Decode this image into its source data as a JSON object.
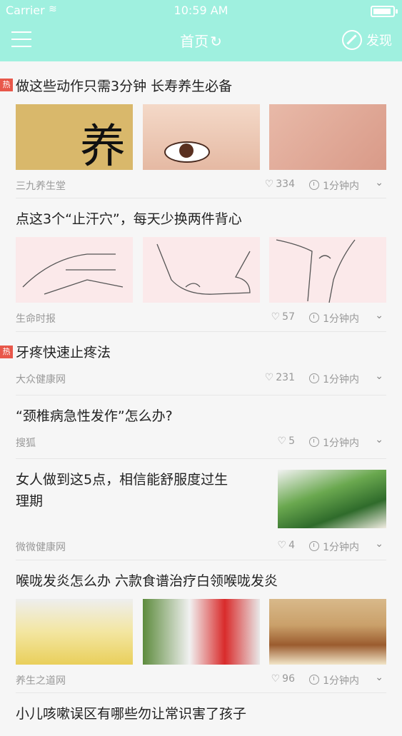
{
  "status_bar": {
    "carrier": "Carrier",
    "time": "10:59 AM"
  },
  "header": {
    "title": "首页",
    "discover_label": "发现"
  },
  "feed": [
    {
      "title": "做这些动作只需3分钟 长寿养生必备",
      "hot": "热",
      "source": "三九养生堂",
      "likes": "334",
      "time": "1分钟内",
      "thumb_text": "养"
    },
    {
      "title": "点这3个“止汗穴”，每天少换两件背心",
      "hot": "",
      "source": "生命时报",
      "likes": "57",
      "time": "1分钟内"
    },
    {
      "title": "牙疼快速止疼法",
      "hot": "热",
      "source": "大众健康网",
      "likes": "231",
      "time": "1分钟内"
    },
    {
      "title": "“颈椎病急性发作”怎么办?",
      "hot": "",
      "source": "搜狐",
      "likes": "5",
      "time": "1分钟内"
    },
    {
      "title_line1": "女人做到这5点，相信能舒服度过生",
      "title_line2": "理期",
      "hot": "",
      "source": "微微健康网",
      "likes": "4",
      "time": "1分钟内"
    },
    {
      "title": "喉咙发炎怎么办 六款食谱治疗白领喉咙发炎",
      "hot": "",
      "source": "养生之道网",
      "likes": "96",
      "time": "1分钟内"
    },
    {
      "title": "小儿咳嗽误区有哪些勿让常识害了孩子",
      "hot": ""
    }
  ],
  "icons": {
    "heart": "♡",
    "chevron": "⌄",
    "refresh": "↻",
    "wifi": "≋"
  },
  "colors": {
    "header_bg": "#9ff0df",
    "hot_badge": "#e8574a"
  }
}
